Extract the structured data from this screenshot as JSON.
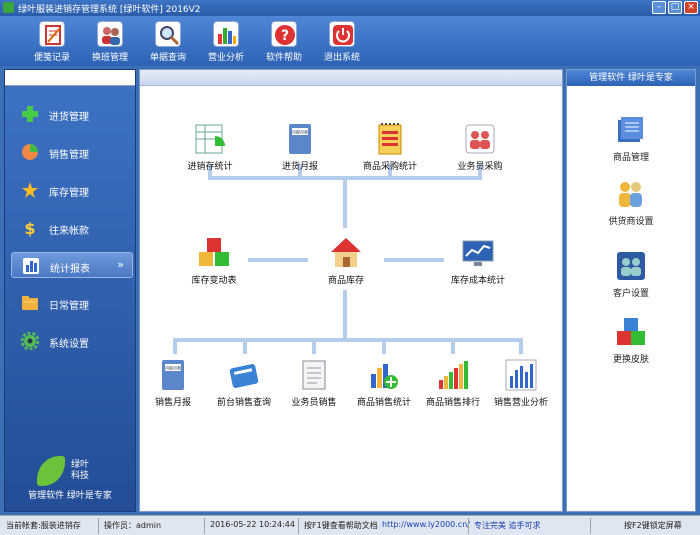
{
  "window": {
    "title": "绿叶服装进销存管理系统 [绿叶软件] 2016V2"
  },
  "toolbar": {
    "items": [
      {
        "label": "便笺记录",
        "icon": "notepad-icon"
      },
      {
        "label": "换班管理",
        "icon": "users-swap-icon"
      },
      {
        "label": "单据查询",
        "icon": "magnifier-icon"
      },
      {
        "label": "营业分析",
        "icon": "bar-chart-icon"
      },
      {
        "label": "软件帮助",
        "icon": "help-icon"
      },
      {
        "label": "退出系统",
        "icon": "power-icon"
      }
    ]
  },
  "sidebar": {
    "items": [
      {
        "label": "进货管理",
        "icon": "plus-icon"
      },
      {
        "label": "销售管理",
        "icon": "pie-icon"
      },
      {
        "label": "库存管理",
        "icon": "star-icon"
      },
      {
        "label": "往来帐款",
        "icon": "dollar-icon"
      },
      {
        "label": "统计报表",
        "icon": "bars-icon",
        "active": true
      },
      {
        "label": "日常管理",
        "icon": "folder-icon"
      },
      {
        "label": "系统设置",
        "icon": "gear-icon"
      }
    ],
    "logo_text": "绿叶\n科技",
    "slogan": "管理软件 绿叶是专家"
  },
  "main": {
    "top_row": [
      {
        "label": "进销存统计",
        "icon": "spreadsheet-chart-icon"
      },
      {
        "label": "进货月报",
        "icon": "book-icon",
        "icon_text": "月报月表"
      },
      {
        "label": "商品采购统计",
        "icon": "notebook-icon"
      },
      {
        "label": "业务员采购",
        "icon": "people-icon"
      }
    ],
    "middle_row": [
      {
        "label": "库存变动表",
        "icon": "boxes-icon"
      },
      {
        "label": "商品库存",
        "icon": "house-icon"
      },
      {
        "label": "库存成本统计",
        "icon": "monitor-chart-icon"
      }
    ],
    "bottom_row": [
      {
        "label": "销售月报",
        "icon": "book-icon",
        "icon_text": "月报月表"
      },
      {
        "label": "前台销售查询",
        "icon": "binder-icon"
      },
      {
        "label": "业务员销售",
        "icon": "document-icon"
      },
      {
        "label": "商品销售统计",
        "icon": "chart-add-icon"
      },
      {
        "label": "商品销售排行",
        "icon": "ranking-bars-icon"
      },
      {
        "label": "销售营业分析",
        "icon": "analysis-chart-icon"
      }
    ]
  },
  "right_panel": {
    "header": "管理软件 绿叶是专家",
    "items": [
      {
        "label": "商品管理",
        "icon": "files-stack-icon"
      },
      {
        "label": "供货商设置",
        "icon": "group-icon"
      },
      {
        "label": "客户设置",
        "icon": "customers-icon"
      },
      {
        "label": "更换皮肤",
        "icon": "cubes-icon"
      }
    ]
  },
  "statusbar": {
    "account": "当前帐套:服装进销存",
    "operator": "操作员：admin",
    "datetime": "2016-05-22 10:24:44",
    "help_hint": "按F1键查看帮助文档",
    "url": "http://www.ly2000.cn/",
    "motto": "专注完美 追手可求",
    "lock_hint": "按F2键锁定屏幕"
  },
  "colors": {
    "accent": "#2d62b4",
    "connector": "#b4cdea",
    "active_nav": "#6f9adc"
  }
}
